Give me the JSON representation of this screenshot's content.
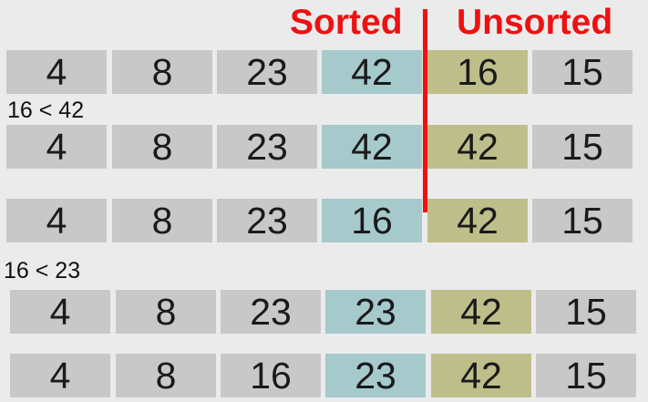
{
  "headers": {
    "sorted": "Sorted",
    "unsorted": "Unsorted"
  },
  "colors": {
    "background": "#ebebeb",
    "default_cell": "#c8c8c8",
    "sorted_highlight": "#a6c9cc",
    "unsorted_highlight": "#bebe8a",
    "divider": "#ee1111",
    "header_text": "#ee1111"
  },
  "rows": [
    {
      "cells": [
        {
          "value": "4",
          "tone": "default"
        },
        {
          "value": "8",
          "tone": "default"
        },
        {
          "value": "23",
          "tone": "default"
        },
        {
          "value": "42",
          "tone": "sorted"
        },
        {
          "value": "16",
          "tone": "unsorted"
        },
        {
          "value": "15",
          "tone": "default"
        }
      ]
    },
    {
      "note": "16 < 42",
      "cells": [
        {
          "value": "4",
          "tone": "default"
        },
        {
          "value": "8",
          "tone": "default"
        },
        {
          "value": "23",
          "tone": "default"
        },
        {
          "value": "42",
          "tone": "sorted"
        },
        {
          "value": "42",
          "tone": "unsorted"
        },
        {
          "value": "15",
          "tone": "default"
        }
      ]
    },
    {
      "cells": [
        {
          "value": "4",
          "tone": "default"
        },
        {
          "value": "8",
          "tone": "default"
        },
        {
          "value": "23",
          "tone": "default"
        },
        {
          "value": "16",
          "tone": "sorted"
        },
        {
          "value": "42",
          "tone": "unsorted"
        },
        {
          "value": "15",
          "tone": "default"
        }
      ]
    },
    {
      "note": "16 < 23",
      "cells": [
        {
          "value": "4",
          "tone": "default"
        },
        {
          "value": "8",
          "tone": "default"
        },
        {
          "value": "23",
          "tone": "default"
        },
        {
          "value": "23",
          "tone": "sorted"
        },
        {
          "value": "42",
          "tone": "unsorted"
        },
        {
          "value": "15",
          "tone": "default"
        }
      ]
    },
    {
      "cells": [
        {
          "value": "4",
          "tone": "default"
        },
        {
          "value": "8",
          "tone": "default"
        },
        {
          "value": "16",
          "tone": "default"
        },
        {
          "value": "23",
          "tone": "sorted"
        },
        {
          "value": "42",
          "tone": "unsorted"
        },
        {
          "value": "15",
          "tone": "default"
        }
      ]
    }
  ]
}
